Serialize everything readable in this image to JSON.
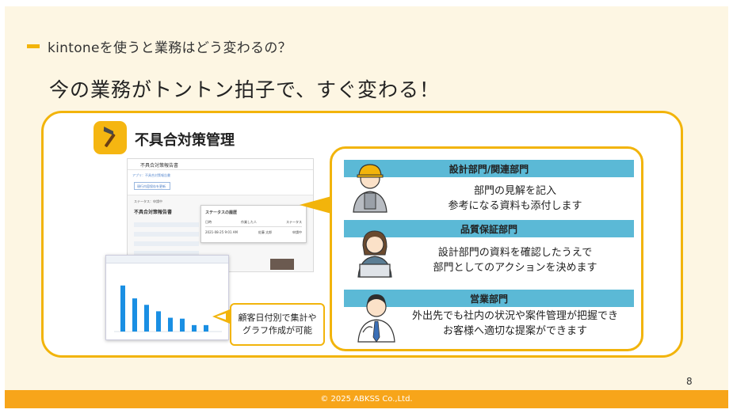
{
  "heading": "kintoneを使うと業務はどう変わるの？",
  "main_title": "今の業務がトントン拍子で、すぐ変わる！",
  "app": {
    "title": "不具合対策管理",
    "icon": "hammer-icon"
  },
  "screenshot": {
    "app_name": "不具合対策報告書",
    "breadcrumb": "アプリ：不具合対策報告書",
    "button": "現行内容保存を更新",
    "status_line": "ステータス：申請中",
    "record_title": "不具合対策報告書",
    "popup_title": "ステータスの履歴",
    "popup_cols": [
      "日時",
      "作業した人",
      "ステータス"
    ],
    "popup_row": [
      "2021-08-25 9:01 AM",
      "佐藤 太郎",
      "申請中"
    ]
  },
  "chart_data": {
    "type": "bar",
    "categories": [
      "",
      "",
      "",
      "",
      "",
      "",
      "",
      ""
    ],
    "values": [
      100,
      72,
      58,
      44,
      30,
      28,
      14,
      14
    ],
    "title": "",
    "xlabel": "",
    "ylabel": "",
    "ylim": [
      0,
      110
    ]
  },
  "callout": {
    "line1": "顧客日付別で集計や",
    "line2": "グラフ作成が可能"
  },
  "departments": [
    {
      "name": "設計部門/関連部門",
      "line1": "部門の見解を記入",
      "line2": "参考になる資料も添付します",
      "icon": "construction-worker-icon"
    },
    {
      "name": "品質保証部門",
      "line1": "設計部門の資料を確認したうえで",
      "line2": "部門としてのアクションを決めます",
      "icon": "office-worker-laptop-icon"
    },
    {
      "name": "営業部門",
      "line1": "外出先でも社内の状況や案件管理が把握でき",
      "line2": "お客様へ適切な提案ができます",
      "icon": "salesman-icon"
    }
  ],
  "page_number": "8",
  "footer": "© 2025 ABKSS Co.,Ltd.",
  "colors": {
    "accent": "#f2b40b",
    "dept_header": "#5bb9d6",
    "footer": "#f7a51a",
    "background": "#fdf6e3"
  }
}
